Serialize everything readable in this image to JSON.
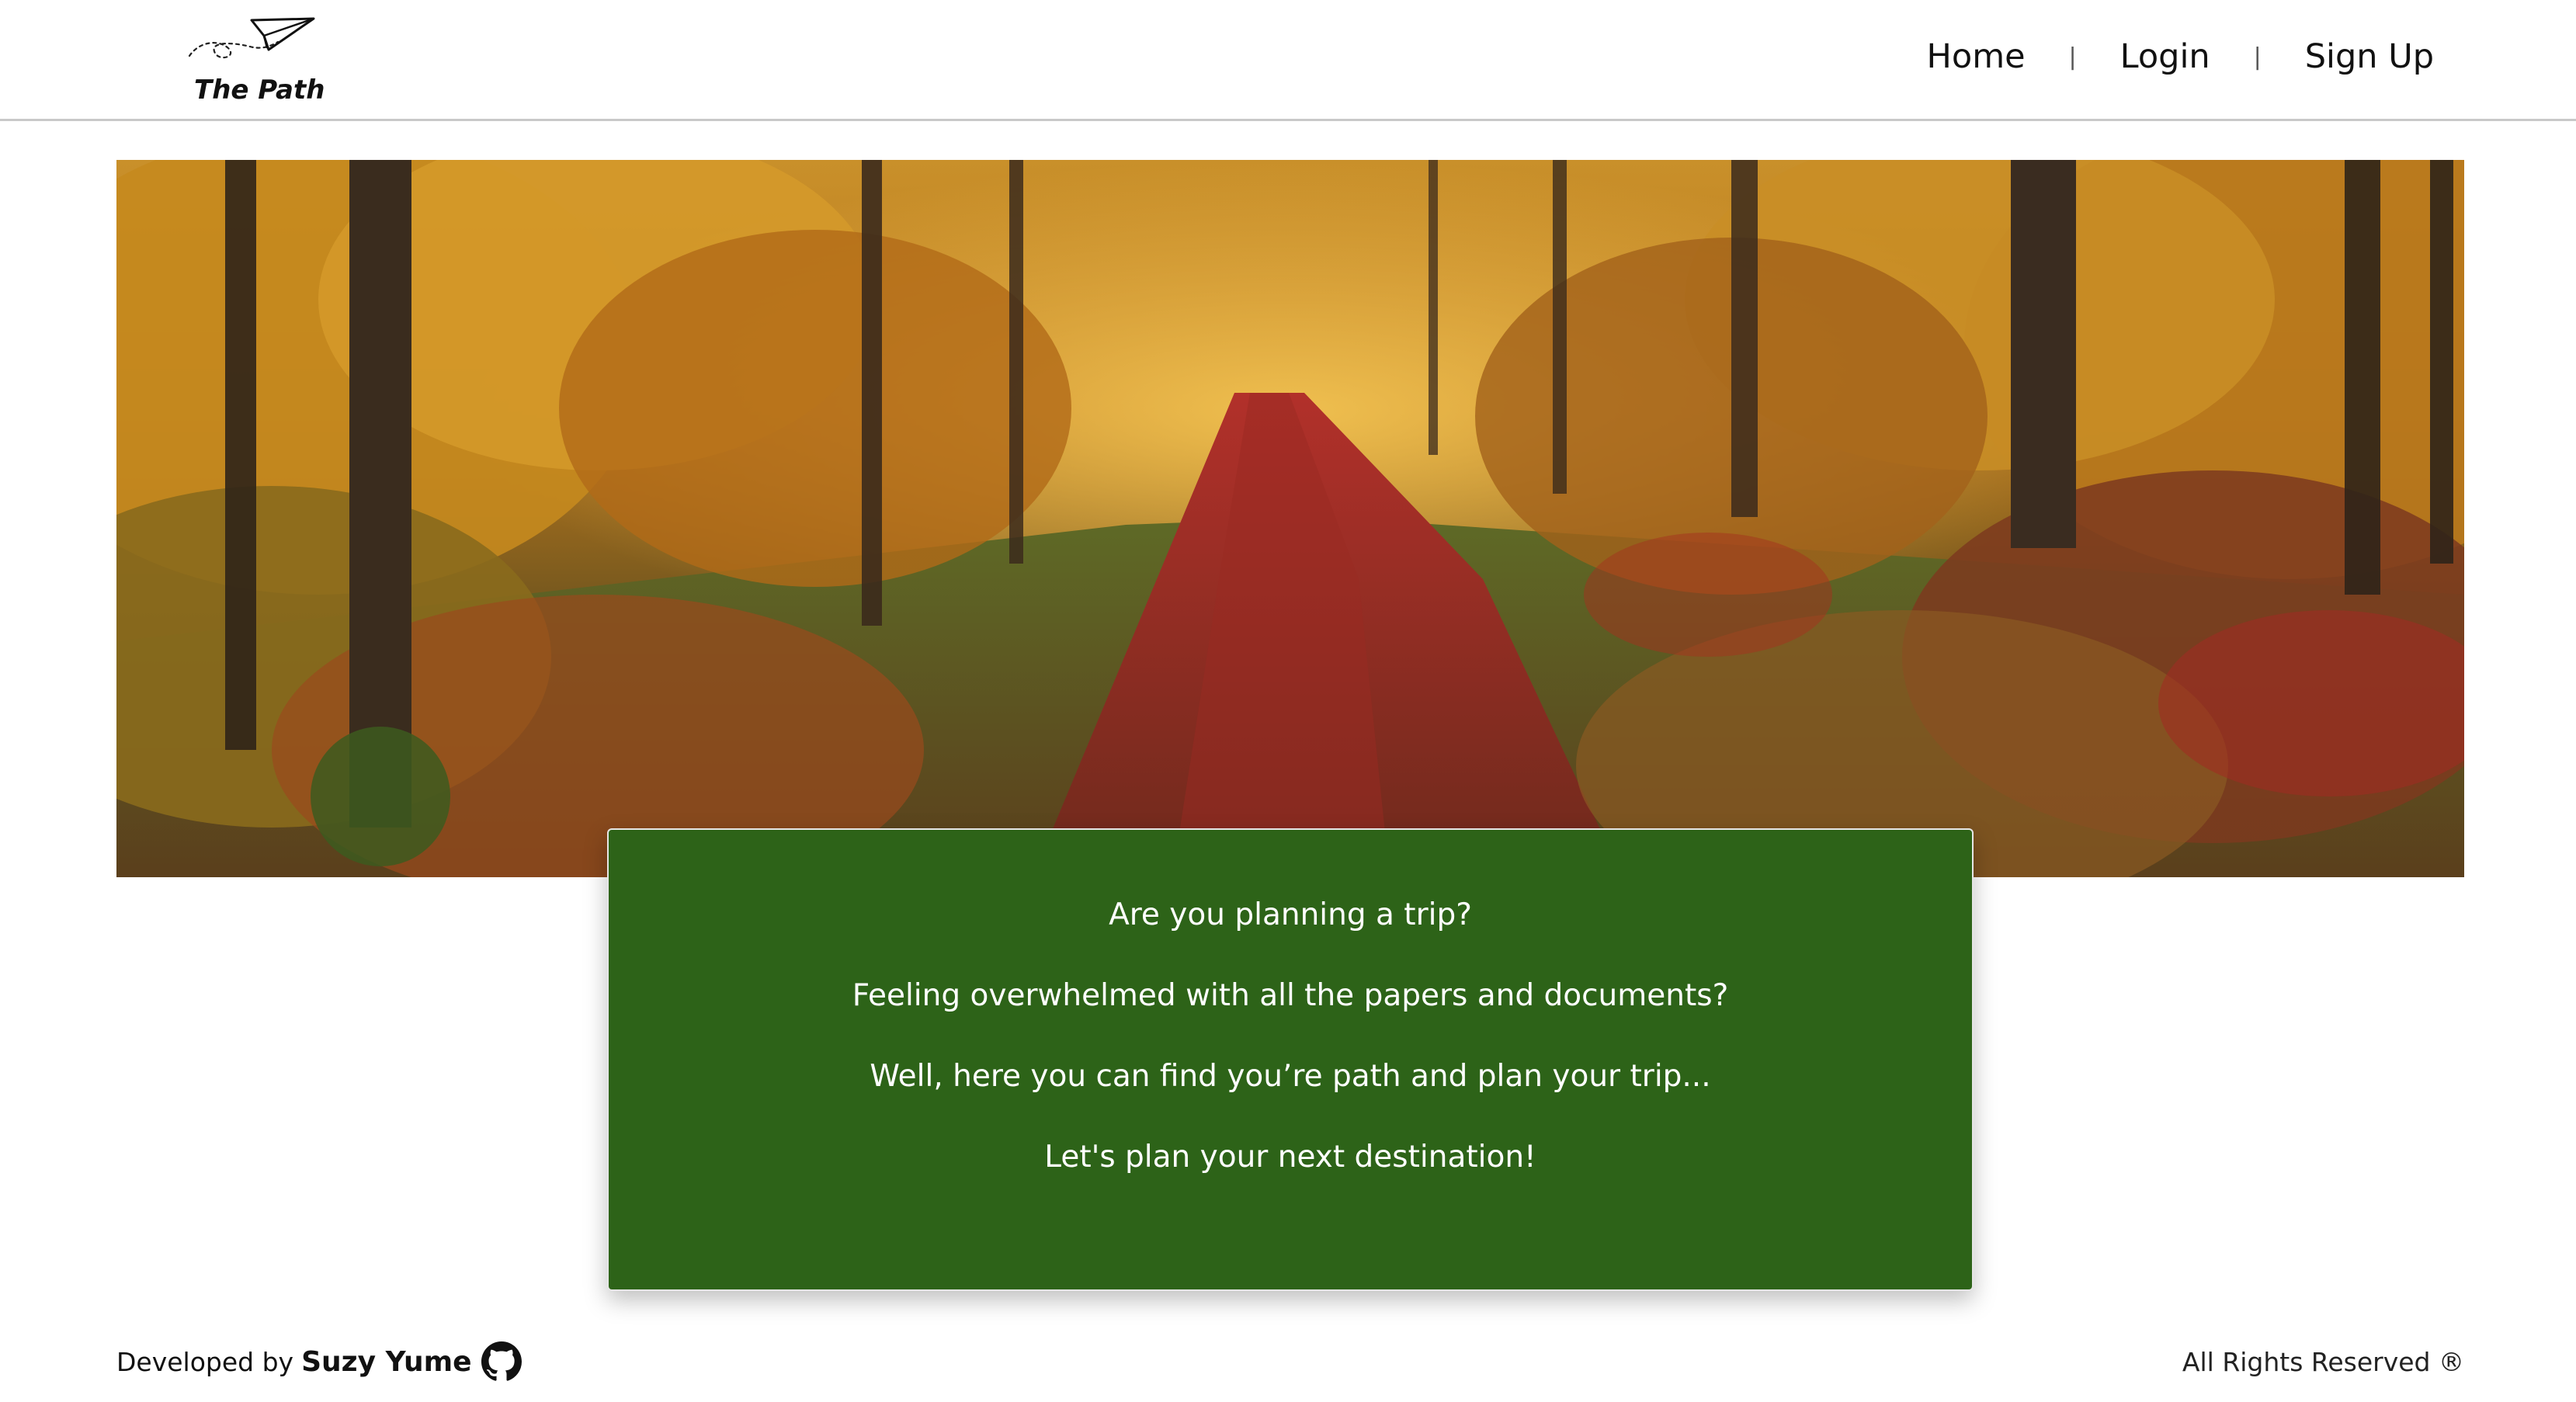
{
  "header": {
    "logo_text": "The Path",
    "nav": {
      "home": "Home",
      "login": "Login",
      "signup": "Sign Up",
      "separator": "|"
    }
  },
  "hero": {
    "image_label": "autumn forest path"
  },
  "card": {
    "lines": [
      "Are you planning a trip?",
      "Feeling overwhelmed with all the papers and documents?",
      "Well, here you can find you’re path and plan your trip...",
      "Let's plan your next destination!"
    ]
  },
  "footer": {
    "developed_by": "Developed by",
    "developer": "Suzy Yume",
    "rights": "All Rights Reserved ®"
  },
  "colors": {
    "card_bg": "#2d6318",
    "card_text": "#ffffff",
    "header_border": "#c9c9c9"
  },
  "icons": {
    "logo": "paper-plane-icon",
    "github": "github-icon"
  }
}
